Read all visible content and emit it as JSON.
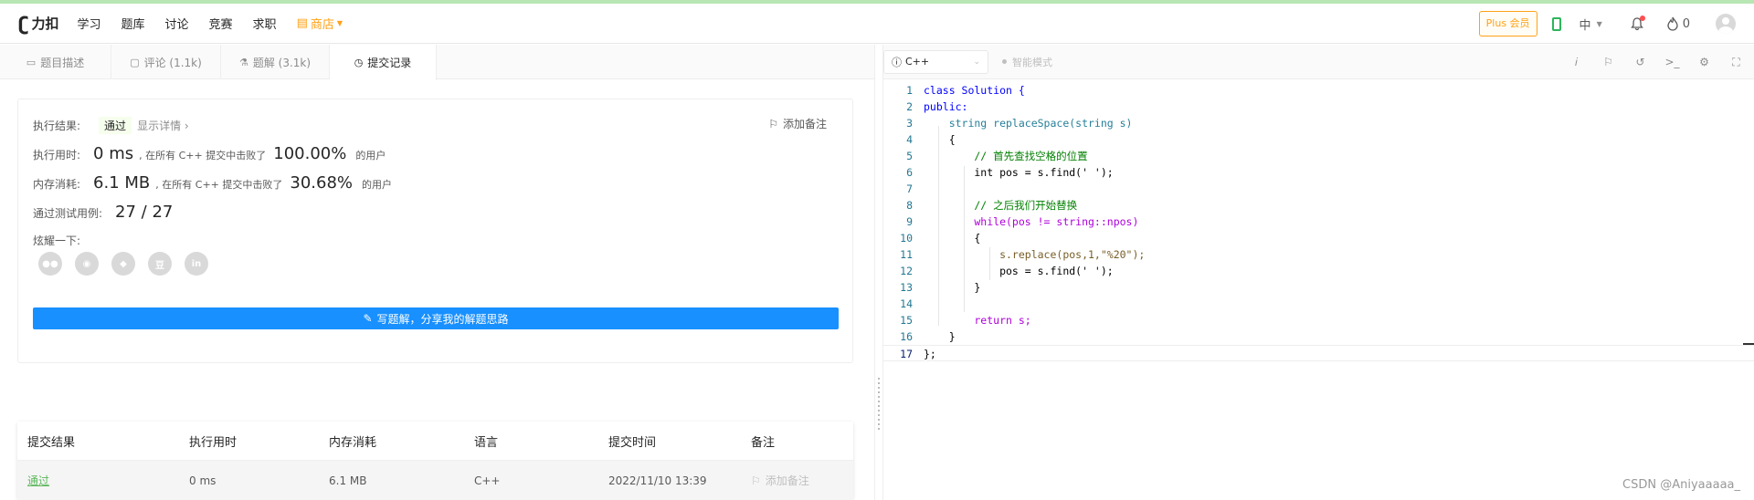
{
  "header": {
    "logo_text": "力扣",
    "nav": [
      "学习",
      "题库",
      "讨论",
      "竞赛",
      "求职",
      "商店"
    ],
    "plus_label": "Plus 会员",
    "lang_label": "中",
    "points": "0"
  },
  "tabs": [
    {
      "label": "题目描述",
      "icon": "description-icon"
    },
    {
      "label": "评论 (1.1k)",
      "icon": "comment-icon"
    },
    {
      "label": "题解 (3.1k)",
      "icon": "flask-icon"
    },
    {
      "label": "提交记录",
      "icon": "clock-icon"
    }
  ],
  "result": {
    "exec_result_label": "执行结果:",
    "status": "通过",
    "detail_link": "显示详情 ›",
    "add_note": "添加备注",
    "time_label": "执行用时:",
    "time_value": "0 ms",
    "time_text": ", 在所有 C++ 提交中击败了",
    "time_pct": "100.00%",
    "time_suffix": "的用户",
    "mem_label": "内存消耗:",
    "mem_value": "6.1 MB",
    "mem_text": ", 在所有 C++ 提交中击败了",
    "mem_pct": "30.68%",
    "mem_suffix": "的用户",
    "cases_label": "通过测试用例:",
    "cases_value": "27 / 27",
    "share_label": "炫耀一下:",
    "share_icons": [
      "wechat-icon",
      "weibo-icon",
      "qq-icon",
      "douban-icon",
      "linkedin-icon"
    ],
    "write_solution": "写题解，分享我的解题思路"
  },
  "submissions": {
    "headers": [
      "提交结果",
      "执行用时",
      "内存消耗",
      "语言",
      "提交时间",
      "备注"
    ],
    "rows": [
      {
        "status": "通过",
        "time": "0 ms",
        "memory": "6.1 MB",
        "lang": "C++",
        "submitted": "2022/11/10 13:39",
        "note": "添加备注"
      }
    ]
  },
  "editor": {
    "language": "C++",
    "smart_mode": "智能模式",
    "code_lines": [
      "class Solution {",
      "public:",
      "    string replaceSpace(string s)",
      "    {",
      "        // 首先查找空格的位置",
      "        int pos = s.find(' ');",
      "",
      "        // 之后我们开始替换",
      "        while(pos != string::npos)",
      "        {",
      "            s.replace(pos,1,\"%20\");",
      "            pos = s.find(' ');",
      "        }",
      "",
      "        return s;",
      "    }",
      "};"
    ]
  },
  "watermark": "CSDN @Aniyaaaaa_"
}
